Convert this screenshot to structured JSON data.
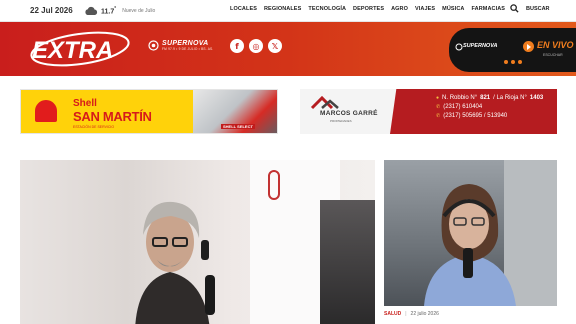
{
  "topbar": {
    "date": "22 Jul 2026",
    "temperature": "11.7",
    "temperature_unit": "°",
    "city": "Nueve de Julio",
    "weather_icon": "cloud-icon",
    "nav": [
      "LOCALES",
      "REGIONALES",
      "TECNOLOGÍA",
      "DEPORTES",
      "AGRO",
      "VIAJES",
      "MÚSICA",
      "FARMACIAS"
    ],
    "search_label": "BUSCAR"
  },
  "header": {
    "logo_text": "EXTRA",
    "radio_name": "SUPERNOVA",
    "radio_sub": "FM 97.9 • 9 DE JULIO • BS. AS.",
    "socials": [
      "f",
      "◎",
      "𝕏"
    ],
    "live": {
      "radio_name": "SUPERNOVA",
      "label": "EN VIVO",
      "sub": "ESCUCHAR"
    }
  },
  "ads": {
    "shell": {
      "brand": "Shell",
      "name": "SAN MARTÍN",
      "tagline": "ESTACIÓN DE SERVICIO",
      "sign": "SHELL SELECT"
    },
    "marcos": {
      "name": "MARCOS GARRÉ",
      "subtitle": "PROPIEDADES",
      "address_prefix": "N. Robbio N°",
      "address_num1": "821",
      "address_mid": "/ La Rioja N°",
      "address_num2": "1403",
      "phone1": "(2317) 610404",
      "phone2": "(2317) 505695 / 513940"
    }
  },
  "side_article": {
    "category": "SALUD",
    "date": "22 julio 2026"
  },
  "colors": {
    "brand_red": "#c91e1c",
    "accent_orange": "#f07d1e"
  }
}
